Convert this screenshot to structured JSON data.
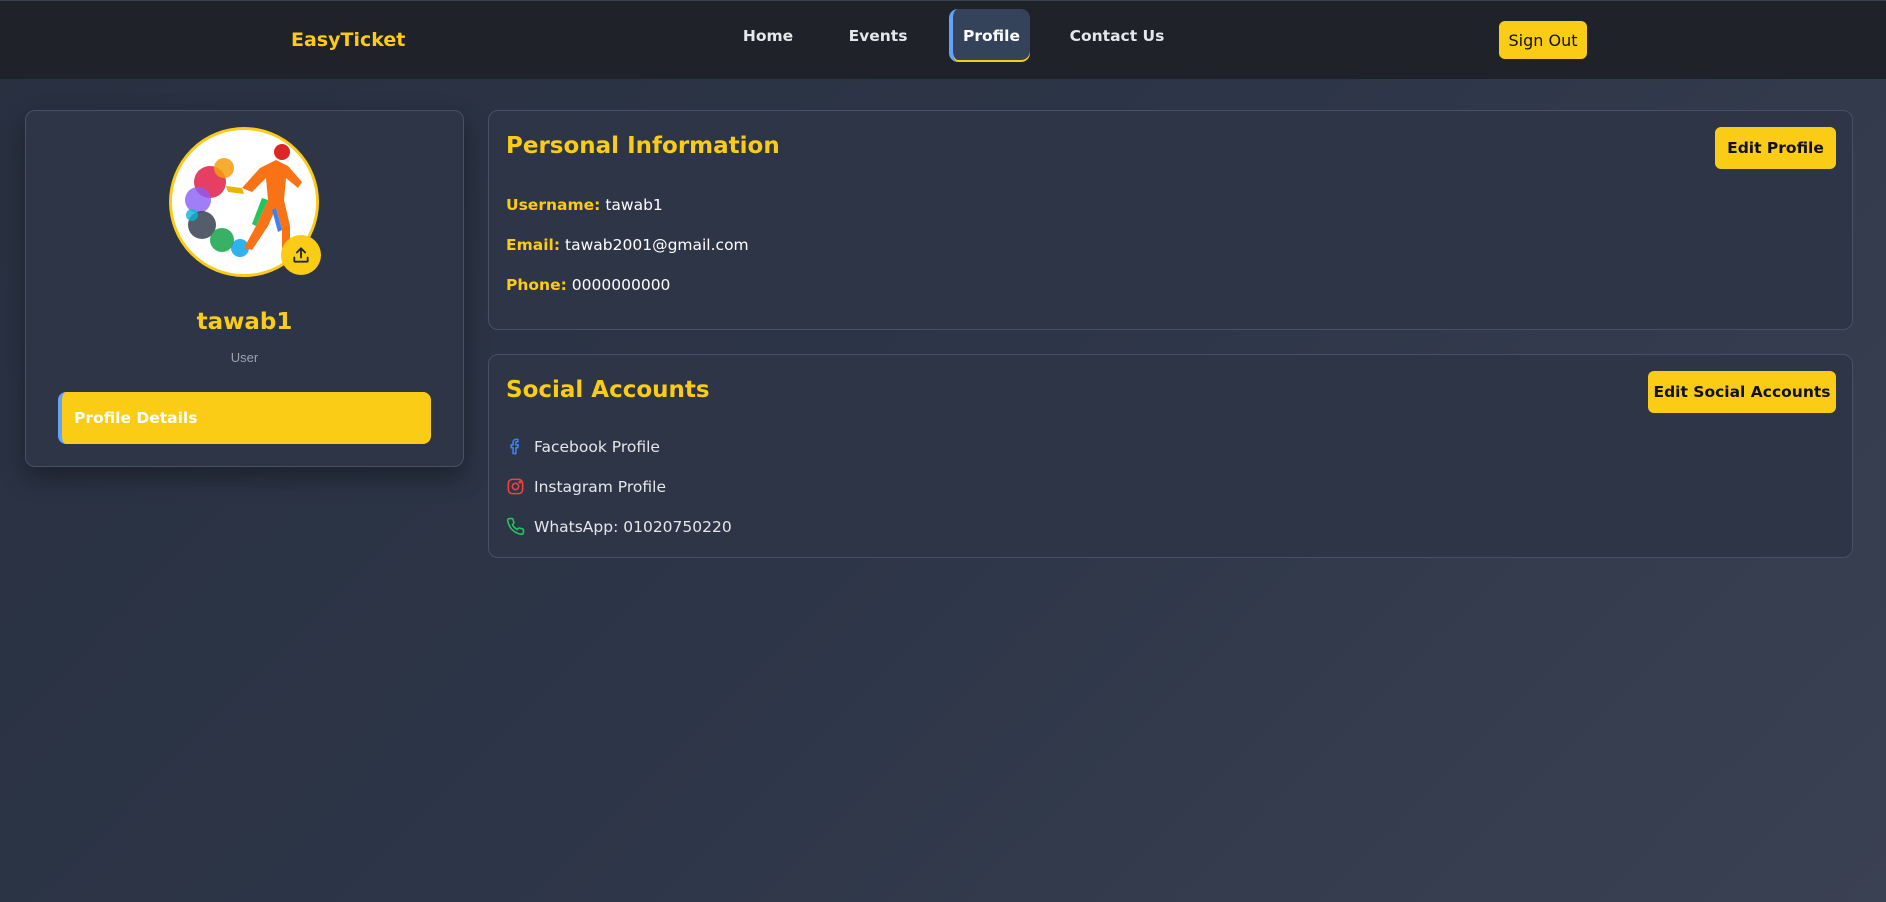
{
  "nav": {
    "brand": "EasyTicket",
    "links": [
      {
        "label": "Home",
        "active": false
      },
      {
        "label": "Events",
        "active": false
      },
      {
        "label": "Profile",
        "active": true
      },
      {
        "label": "Contact Us",
        "active": false
      }
    ],
    "sign_out_label": "Sign Out"
  },
  "profile": {
    "avatar_icon": "avatar-runner-image",
    "upload_icon": "upload-icon",
    "name": "tawab1",
    "role": "User",
    "details_button_label": "Profile Details"
  },
  "personal_info": {
    "title": "Personal Information",
    "edit_label": "Edit Profile",
    "fields": [
      {
        "label": "Username:",
        "value": "tawab1"
      },
      {
        "label": "Email:",
        "value": "tawab2001@gmail.com"
      },
      {
        "label": "Phone:",
        "value": "0000000000"
      }
    ]
  },
  "social": {
    "title": "Social Accounts",
    "edit_label": "Edit Social Accounts",
    "accounts": [
      {
        "icon": "facebook-icon",
        "label": "Facebook Profile",
        "color": "#3b82f6"
      },
      {
        "icon": "instagram-icon",
        "label": "Instagram Profile",
        "color": "#ef4444"
      },
      {
        "icon": "phone-icon",
        "label": "WhatsApp: 01020750220",
        "color": "#22c55e"
      }
    ]
  },
  "colors": {
    "accent": "#facc15",
    "nav_bg": "#1f2228",
    "card_bg": "#2d3547",
    "active_marker": "#60a5fa"
  }
}
